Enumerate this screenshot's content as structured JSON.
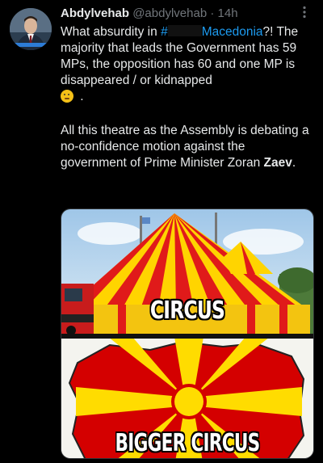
{
  "tweet": {
    "author_name": "Abdylvehab",
    "handle": "@abdylvehab",
    "separator": "·",
    "timestamp": "14h",
    "more_icon": "more-dots-icon",
    "text": {
      "line1_prefix": "What absurdity in ",
      "hashtag_prefix": "#",
      "hashtag_word": "Macedonia",
      "line1_suffix": "?! The majority that leads the Government has 59 MPs, the opposition has 60 and one MP is disappeared / or kidnapped",
      "emoji": "thinking-face-emoji",
      "line1_end": " .",
      "para2_main": "All this theatre as the Assembly is debating a no-confidence motion against the government of Prime Minister Zoran ",
      "para2_bold": "Zaev",
      "para2_end": "."
    },
    "media": {
      "top_caption": "CIRCUS",
      "bottom_caption": "BIGGER CIRCUS"
    }
  },
  "colors": {
    "background": "#000000",
    "text": "#e7e9ea",
    "secondary": "#71767b",
    "link": "#1d9bf0",
    "flag_red": "#d20000",
    "flag_yellow": "#ffe600"
  }
}
